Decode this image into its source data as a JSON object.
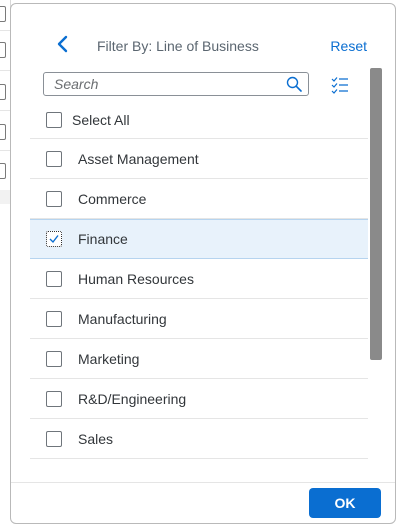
{
  "header": {
    "title": "Filter By: Line of Business",
    "reset_label": "Reset"
  },
  "search": {
    "placeholder": "Search",
    "value": ""
  },
  "list": {
    "select_all_label": "Select All",
    "items": [
      {
        "label": "Asset Management",
        "checked": false
      },
      {
        "label": "Commerce",
        "checked": false
      },
      {
        "label": "Finance",
        "checked": true
      },
      {
        "label": "Human Resources",
        "checked": false
      },
      {
        "label": "Manufacturing",
        "checked": false
      },
      {
        "label": "Marketing",
        "checked": false
      },
      {
        "label": "R&D/Engineering",
        "checked": false
      },
      {
        "label": "Sales",
        "checked": false
      }
    ]
  },
  "footer": {
    "ok_label": "OK"
  },
  "colors": {
    "accent": "#0a6ed1",
    "selected_row": "#e8f2fb",
    "scrollbar": "#8a8a8a"
  },
  "icons": {
    "back": "chevron-left-icon",
    "search": "search-icon",
    "list_toggle": "list-checklist-icon"
  }
}
